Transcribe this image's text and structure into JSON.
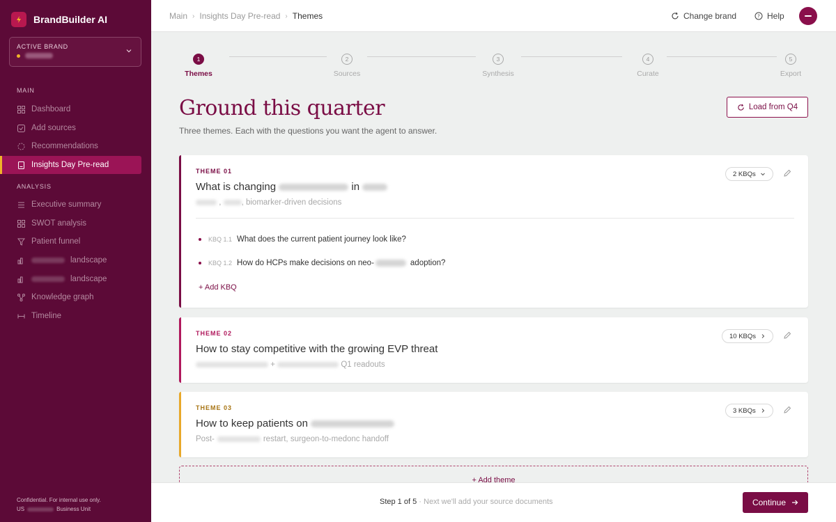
{
  "app": {
    "name": "BrandBuilder AI"
  },
  "active_brand": {
    "label": "ACTIVE BRAND"
  },
  "sidebar": {
    "sections": [
      "MAIN",
      "ANALYSIS"
    ],
    "main_items": [
      {
        "label": "Dashboard",
        "icon": "grid-icon"
      },
      {
        "label": "Add sources",
        "icon": "upload-icon"
      },
      {
        "label": "Recommendations",
        "icon": "sparkle-icon"
      },
      {
        "label": "Insights Day Pre-read",
        "icon": "document-icon",
        "active": true
      }
    ],
    "analysis_items": [
      {
        "label": "Executive summary",
        "icon": "list-icon"
      },
      {
        "label": "SWOT analysis",
        "icon": "grid-icon"
      },
      {
        "label": "Patient funnel",
        "icon": "funnel-icon"
      },
      {
        "label": "landscape",
        "icon": "bar-chart-icon"
      },
      {
        "label": "landscape",
        "icon": "bar-chart-icon"
      },
      {
        "label": "Knowledge graph",
        "icon": "graph-icon"
      },
      {
        "label": "Timeline",
        "icon": "timeline-icon"
      }
    ],
    "footer": {
      "line1": "Confidential. For internal use only.",
      "line2_prefix": "US",
      "line2_suffix": "Business Unit"
    }
  },
  "topbar": {
    "breadcrumb": [
      "Main",
      "Insights Day Pre-read",
      "Themes"
    ],
    "change_brand": "Change brand",
    "help": "Help"
  },
  "stepper": [
    {
      "num": "1",
      "label": "Themes",
      "active": true
    },
    {
      "num": "2",
      "label": "Sources"
    },
    {
      "num": "3",
      "label": "Synthesis"
    },
    {
      "num": "4",
      "label": "Curate"
    },
    {
      "num": "5",
      "label": "Export"
    }
  ],
  "page": {
    "title": "Ground this quarter",
    "subtitle": "Three themes. Each with the questions you want the agent to answer.",
    "load_button": "Load from Q4"
  },
  "themes": [
    {
      "number": "THEME 01",
      "title_prefix": "What is changing",
      "title_mid": "in",
      "subtitle_suffix": ", biomarker-driven decisions",
      "kbq_count": "2 KBQs",
      "accent": "#7a0d45",
      "kbqs": [
        {
          "code": "KBQ 1.1",
          "text": "What does the current patient journey look like?"
        },
        {
          "code": "KBQ 1.2",
          "text_prefix": "How do HCPs make decisions on neo-",
          "text_suffix": "adoption?"
        }
      ],
      "add_kbq": "+ Add KBQ"
    },
    {
      "number": "THEME 02",
      "title": "How to stay competitive with the growing EVP threat",
      "subtitle_mid": "+",
      "subtitle_suffix": "Q1 readouts",
      "kbq_count": "10 KBQs",
      "accent": "#b0185c"
    },
    {
      "number": "THEME 03",
      "title_prefix": "How to keep patients on",
      "subtitle_prefix": "Post-",
      "subtitle_suffix": "restart, surgeon-to-medonc handoff",
      "kbq_count": "3 KBQs",
      "accent": "#e8a82a"
    }
  ],
  "add_theme": "+ Add theme",
  "footer_bar": {
    "step": "Step 1 of 5",
    "next_hint": " · Next we'll add your source documents",
    "continue": "Continue"
  }
}
